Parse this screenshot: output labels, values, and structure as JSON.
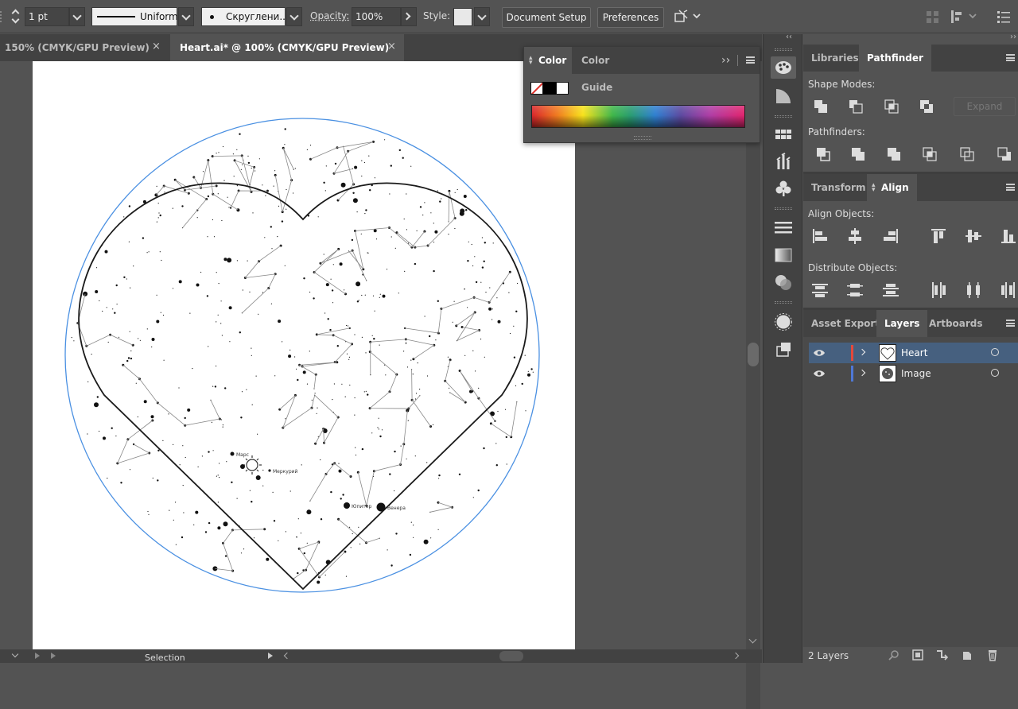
{
  "control_bar": {
    "stroke_weight": "1 pt",
    "stroke_profile": "Uniform",
    "brush": "Скруглени...",
    "opacity_label": "Opacity:",
    "opacity_value": "100%",
    "style_label": "Style:",
    "document_setup": "Document Setup",
    "preferences": "Preferences"
  },
  "tabs": [
    {
      "label": "150% (CMYK/GPU Preview)",
      "close": "×"
    },
    {
      "label": "Heart.ai* @ 100% (CMYK/GPU Preview)",
      "close": "×"
    }
  ],
  "color_panel": {
    "tabs": [
      "Color",
      "Color Guide"
    ],
    "expand_glyph": "››"
  },
  "collapse_glyph": "‹‹",
  "pathfinder_panel": {
    "tabs": [
      "Libraries",
      "Pathfinder"
    ],
    "shape_modes_label": "Shape Modes:",
    "expand_label": "Expand",
    "pathfinders_label": "Pathfinders:"
  },
  "align_panel": {
    "tabs": [
      "Transform",
      "Align"
    ],
    "align_objects_label": "Align Objects:",
    "distribute_objects_label": "Distribute Objects:"
  },
  "layers_panel": {
    "tabs": [
      "Asset Export",
      "Layers",
      "Artboards"
    ],
    "layers": [
      {
        "name": "Heart",
        "color": "#e5483b",
        "selected": true
      },
      {
        "name": "Image",
        "color": "#4f78d6",
        "selected": false
      }
    ],
    "count": "2 Layers"
  },
  "artwork": {
    "planet_labels": [
      "Марс",
      "Меркурий",
      "Юпитер",
      "Венера"
    ],
    "circle_color": "#4a90e2",
    "heart_color": "#1a1a1a"
  },
  "status_bar": {
    "tool": "Selection"
  }
}
